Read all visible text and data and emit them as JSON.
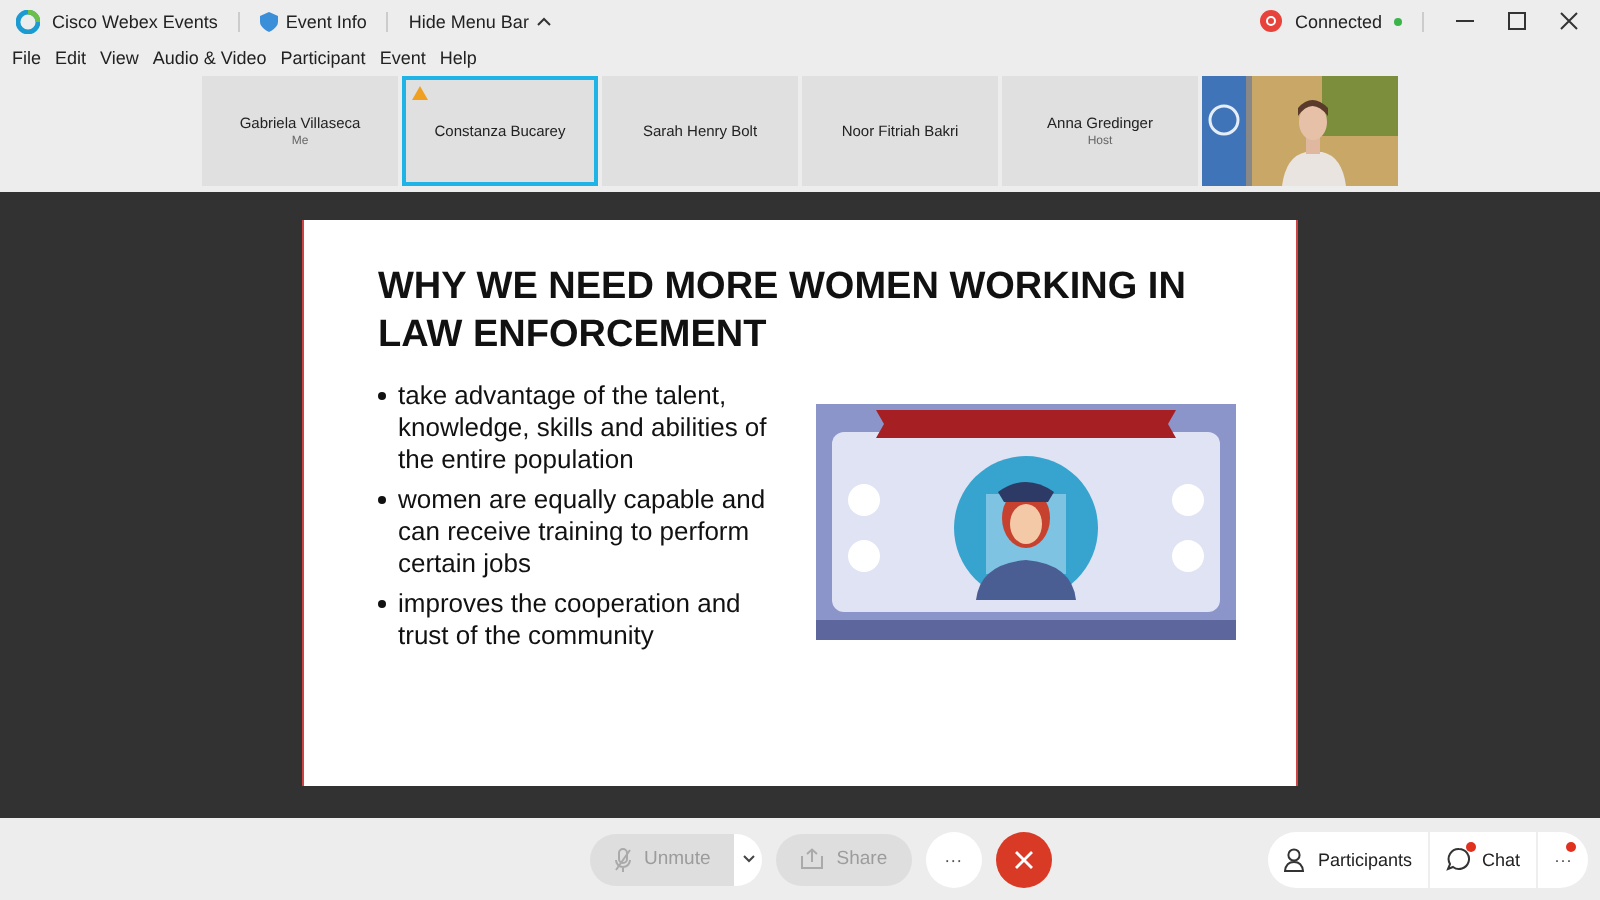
{
  "window": {
    "app_name": "Cisco Webex Events",
    "event_info": "Event Info",
    "hide_menu_bar": "Hide Menu Bar",
    "recording_status": "Connected"
  },
  "menu": [
    "File",
    "Edit",
    "View",
    "Audio & Video",
    "Participant",
    "Event",
    "Help"
  ],
  "participants": [
    {
      "name": "Gabriela Villaseca",
      "role": "Me",
      "selected": false,
      "warning": false,
      "kind": "tile"
    },
    {
      "name": "Constanza Bucarey",
      "selected": true,
      "warning": true,
      "kind": "tile"
    },
    {
      "name": "Sarah Henry Bolt",
      "selected": false,
      "warning": false,
      "kind": "tile"
    },
    {
      "name": "Noor Fitriah Bakri",
      "selected": false,
      "warning": false,
      "kind": "tile"
    },
    {
      "name": "Anna Gredinger",
      "role": "Host",
      "selected": false,
      "warning": false,
      "kind": "tile"
    },
    {
      "kind": "video"
    }
  ],
  "slide": {
    "title": "WHY WE NEED MORE WOMEN WORKING IN LAW ENFORCEMENT",
    "bullets": [
      "take advantage of the talent, knowledge, skills and abilities of the entire population",
      "women are equally capable and can receive training to perform certain jobs",
      "improves the cooperation and trust of the community"
    ]
  },
  "controls": {
    "unmute": "Unmute",
    "share": "Share",
    "more": "···",
    "participants": "Participants",
    "chat": "Chat",
    "chat_unread": true,
    "panel_more": "···",
    "panel_more_unread": true
  }
}
